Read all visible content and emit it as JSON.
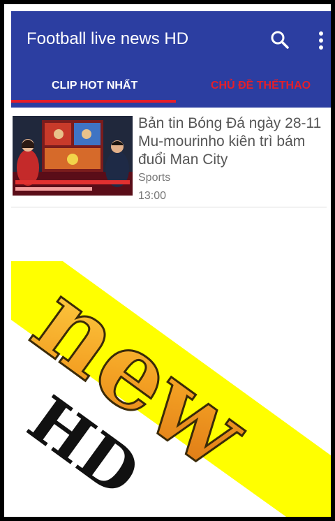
{
  "app_bar": {
    "title": "Football live news HD",
    "color": "#2c3ea1"
  },
  "tabs": [
    {
      "label": "CLIP HOT NHẤT",
      "selected": true
    },
    {
      "label": "CHỦ ĐỀ THỂTHAO",
      "selected": false
    }
  ],
  "accent_color": "#e51e2a",
  "news": [
    {
      "title": "Bản tin Bóng Đá ngày 28-11\nMu-mourinho kiên trì bám\nđuổi Man City",
      "category": "Sports",
      "time": "13:00"
    }
  ],
  "promo": {
    "word": "new",
    "sub": "HD",
    "band_color": "#ffff00"
  },
  "icons": {
    "search": "search-icon",
    "menu": "more-vert-icon"
  }
}
